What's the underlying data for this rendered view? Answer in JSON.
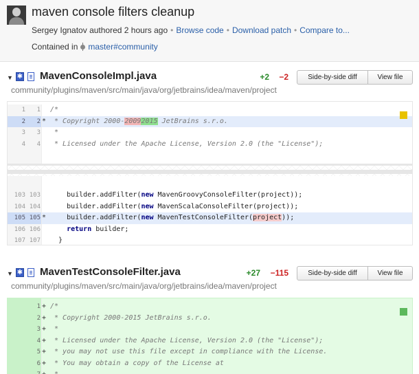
{
  "commit": {
    "title": "maven console filters cleanup",
    "author": "Sergey Ignatov",
    "authored_text": "authored 2 hours ago",
    "links": [
      "Browse code",
      "Download patch",
      "Compare to..."
    ],
    "contained_label": "Contained in",
    "branch": "master#community"
  },
  "files": [
    {
      "name": "MavenConsoleImpl.java",
      "path": "community/plugins/maven/src/main/java/org/jetbrains/idea/maven/project",
      "additions": "+2",
      "deletions": "−2",
      "side_by_side_label": "Side-by-side diff",
      "view_file_label": "View file",
      "marker_color": "#e8c200",
      "hunk1": [
        {
          "a": "1",
          "b": "1",
          "g": "",
          "pre": "/*"
        },
        {
          "a": "2",
          "b": "2",
          "g": "*",
          "pre": " * Copyright 2000-",
          "del": "2009",
          "ins": "2015",
          "post": " JetBrains s.r.o."
        },
        {
          "a": "3",
          "b": "3",
          "g": "",
          "pre": " *"
        },
        {
          "a": "4",
          "b": "4",
          "g": "",
          "pre": " * Licensed under the Apache License, Version 2.0 (the \"License\");"
        }
      ],
      "hunk2": [
        {
          "a": "103",
          "b": "103",
          "g": "",
          "pre": "    builder.addFilter(",
          "kw": "new",
          "post": " MavenGroovyConsoleFilter(project));"
        },
        {
          "a": "104",
          "b": "104",
          "g": "",
          "pre": "    builder.addFilter(",
          "kw": "new",
          "post": " MavenScalaConsoleFilter(project));"
        },
        {
          "a": "105",
          "b": "105",
          "g": "*",
          "pre": "    builder.addFilter(",
          "kw": "new",
          "mid": " MavenTestConsoleFilter(",
          "hl": "project",
          "post": "));"
        },
        {
          "a": "106",
          "b": "106",
          "g": "",
          "pre": "    ",
          "kw": "return",
          "post": " builder;"
        },
        {
          "a": "107",
          "b": "107",
          "g": "",
          "pre": "  }"
        }
      ]
    },
    {
      "name": "MavenTestConsoleFilter.java",
      "path": "community/plugins/maven/src/main/java/org/jetbrains/idea/maven/project",
      "additions": "+27",
      "deletions": "−115",
      "side_by_side_label": "Side-by-side diff",
      "view_file_label": "View file",
      "marker_color": "#5cb85c",
      "lines": [
        {
          "b": "1",
          "g": "+",
          "pre": "/*"
        },
        {
          "b": "2",
          "g": "+",
          "pre": " * Copyright 2000-2015 JetBrains s.r.o."
        },
        {
          "b": "3",
          "g": "+",
          "pre": " *"
        },
        {
          "b": "4",
          "g": "+",
          "pre": " * Licensed under the Apache License, Version 2.0 (the \"License\");"
        },
        {
          "b": "5",
          "g": "+",
          "pre": " * you may not use this file except in compliance with the License."
        },
        {
          "b": "6",
          "g": "+",
          "pre": " * You may obtain a copy of the License at"
        },
        {
          "b": "7",
          "g": "+",
          "pre": " *"
        }
      ]
    }
  ]
}
